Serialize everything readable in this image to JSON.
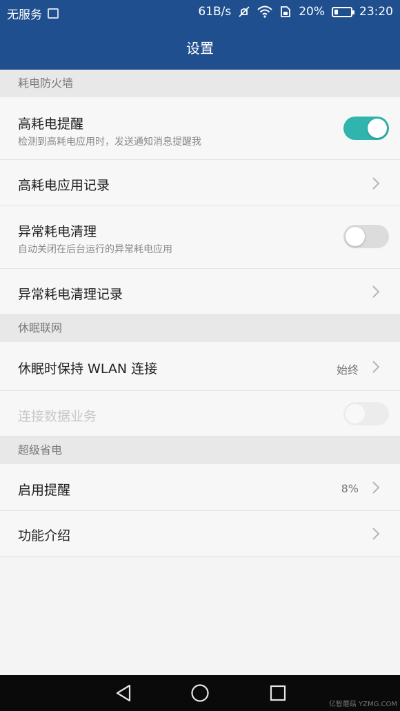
{
  "status_bar": {
    "carrier": "无服务",
    "speed": "61B/s",
    "battery": "20%",
    "time": "23:20",
    "icons": [
      "image-notification-icon",
      "mute-icon",
      "wifi-icon",
      "sim-icon",
      "battery-icon"
    ]
  },
  "header": {
    "title": "设置"
  },
  "sections": [
    {
      "title": "耗电防火墙"
    },
    {
      "title": "休眠联网"
    },
    {
      "title": "超级省电"
    }
  ],
  "rows": {
    "high_usage_alert": {
      "label": "高耗电提醒",
      "sub": "检测到高耗电应用时，发送通知消息提醒我",
      "toggle": "on"
    },
    "high_usage_log": {
      "label": "高耗电应用记录"
    },
    "abnormal_clean": {
      "label": "异常耗电清理",
      "sub": "自动关闭在后台运行的异常耗电应用",
      "toggle": "off"
    },
    "abnormal_clean_log": {
      "label": "异常耗电清理记录"
    },
    "wlan_sleep": {
      "label": "休眠时保持 WLAN 连接",
      "value": "始终"
    },
    "data_service": {
      "label": "连接数据业务",
      "toggle": "disabled"
    },
    "enable_alert": {
      "label": "启用提醒",
      "value": "8%"
    },
    "intro": {
      "label": "功能介绍"
    }
  },
  "colors": {
    "header": "#1f4f8f",
    "toggle_on": "#2fb5ad"
  },
  "watermark": "亿智蘑菇 YZMG.COM"
}
